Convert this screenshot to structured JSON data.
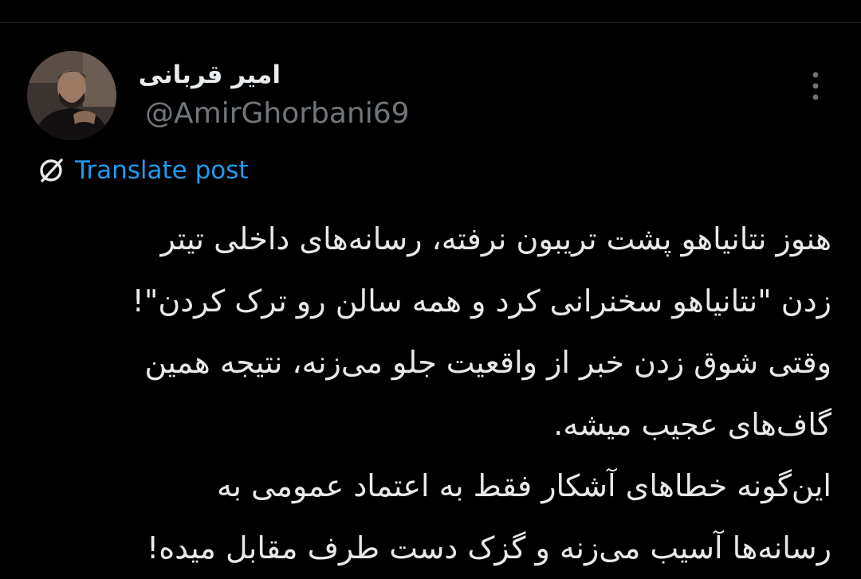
{
  "author": {
    "display_name": "امیر قربانی",
    "handle": "@AmirGhorbani69",
    "avatar_icon": "profile-photo"
  },
  "menu": {
    "icon": "more-vertical-icon"
  },
  "translate": {
    "label": "Translate post",
    "icon": "translate-globe-slash-icon"
  },
  "post": {
    "lines": [
      "هنوز نتانیاهو پشت تریبون نرفته، رسانه‌های داخلی تیتر",
      "زدن \"نتانیاهو سخنرانی کرد و همه سالن رو ترک کردن\"!",
      "وقتی شوق زدن خبر از واقعیت جلو می‌زنه، نتیجه همین",
      "گاف‌های عجیب میشه.",
      "این‌گونه خطاهای آشکار فقط به اعتماد عمومی به",
      "رسانه‌ها آسیب می‌زنه و گزک دست طرف مقابل میده!"
    ]
  },
  "colors": {
    "background": "#000000",
    "text": "#e7e9ea",
    "secondary": "#71767b",
    "link": "#1d9bf0"
  }
}
